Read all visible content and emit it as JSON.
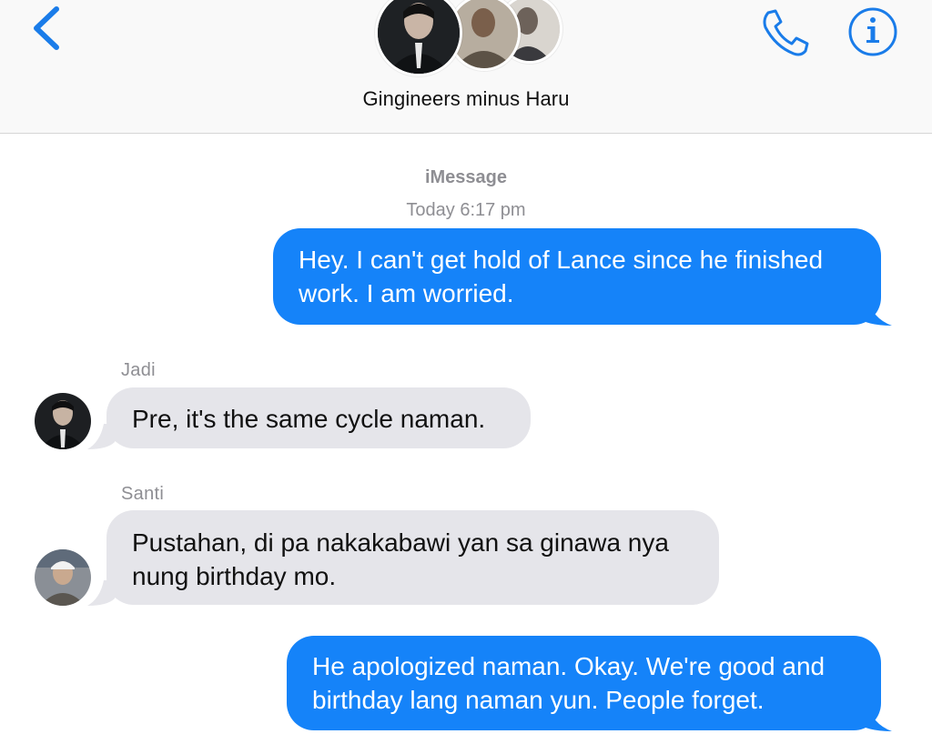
{
  "header": {
    "group_name": "Gingineers minus Haru",
    "back_icon": "chevron-left-icon",
    "call_icon": "phone-icon",
    "info_icon": "info-icon",
    "accent_color": "#1a7ce9"
  },
  "conversation": {
    "service_label": "iMessage",
    "timestamp": "Today 6:17 pm",
    "messages": [
      {
        "direction": "outgoing",
        "lines": [
          "Hey. I can't get hold of Lance since he finished",
          "work. I am worried."
        ]
      },
      {
        "direction": "incoming",
        "sender": "Jadi",
        "lines": [
          "Pre, it's the same cycle naman."
        ]
      },
      {
        "direction": "incoming",
        "sender": "Santi",
        "lines": [
          "Pustahan, di pa nakakabawi yan sa ginawa nya",
          "nung birthday mo."
        ]
      },
      {
        "direction": "outgoing",
        "lines": [
          "He apologized naman. Okay. We're good and",
          "birthday lang naman yun. People forget."
        ]
      }
    ],
    "outgoing_bubble_color": "#1583f9",
    "incoming_bubble_color": "#e5e5ea"
  }
}
